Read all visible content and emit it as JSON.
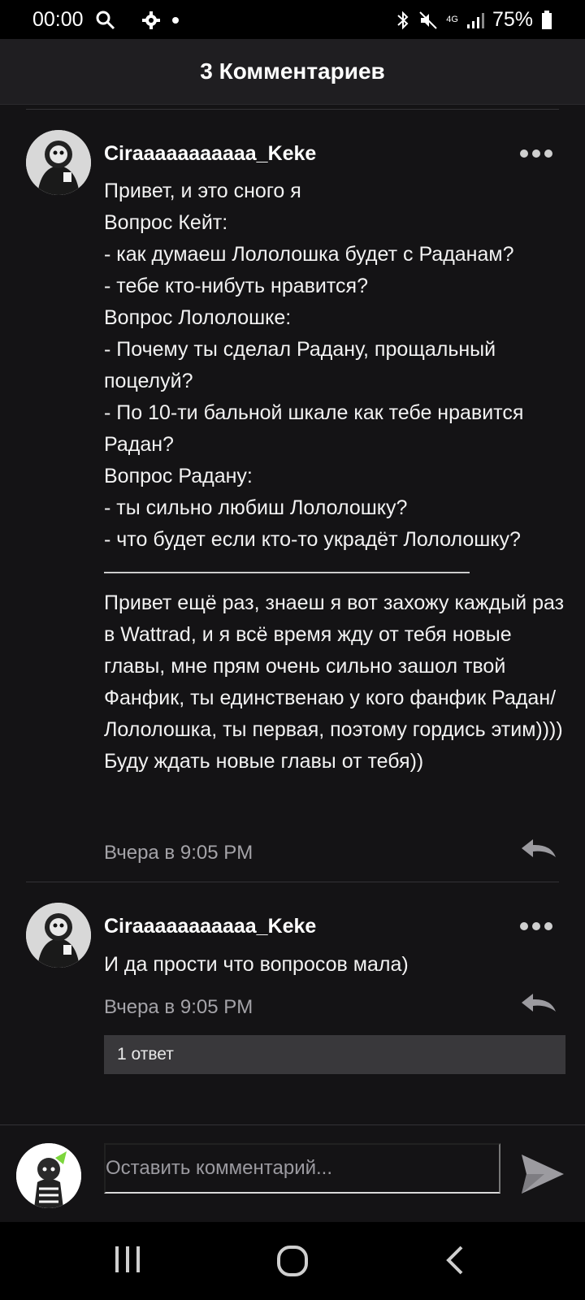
{
  "status_bar": {
    "time": "00:00",
    "battery": "75%",
    "network": "4G"
  },
  "header": {
    "title": "3 Комментариев"
  },
  "comments": [
    {
      "author": "Ciraaaaaaaaaaa_Keke",
      "text": "Привет, и это сного я\nВопрос Кейт:\n- как думаеш Лололошка будет с Раданам?\n- тебе кто-нибуть нравится?\nВопрос Лололошке:\n- Почему ты сделал Радану, прощальный поцелуй?\n- По 10-ти бальной шкале как тебе нравится Радан?\nВопрос Радану:\n- ты сильно любиш Лололошку?\n- что будет если кто-то украдёт Лололошку?\n——————————————————\nПривет ещё раз, знаеш я вот захожу каждый раз в Wattrad, и я всё время жду от тебя новые главы, мне прям очень сильно зашол твой Фанфик, ты единственаю у кого фанфик Радан/Лололошка, ты первая, поэтому гордись этим)))) Буду ждать новые главы от тебя))",
      "time": "Вчера в 9:05 PM"
    },
    {
      "author": "Ciraaaaaaaaaaa_Keke",
      "text": "И да прости что вопросов мала)",
      "time": "Вчера в 9:05 PM",
      "replies_label": "1 ответ"
    }
  ],
  "composer": {
    "placeholder": "Оставить комментарий..."
  },
  "icons": {
    "more": "more-dots-icon",
    "reply": "reply-arrow-icon",
    "send": "send-icon",
    "nav_recents": "recents-icon",
    "nav_home": "home-icon",
    "nav_back": "back-icon"
  },
  "colors": {
    "background": "#141315",
    "header": "#1f1e21",
    "muted_text": "#a4a3a8",
    "replies_box": "#39383b"
  }
}
